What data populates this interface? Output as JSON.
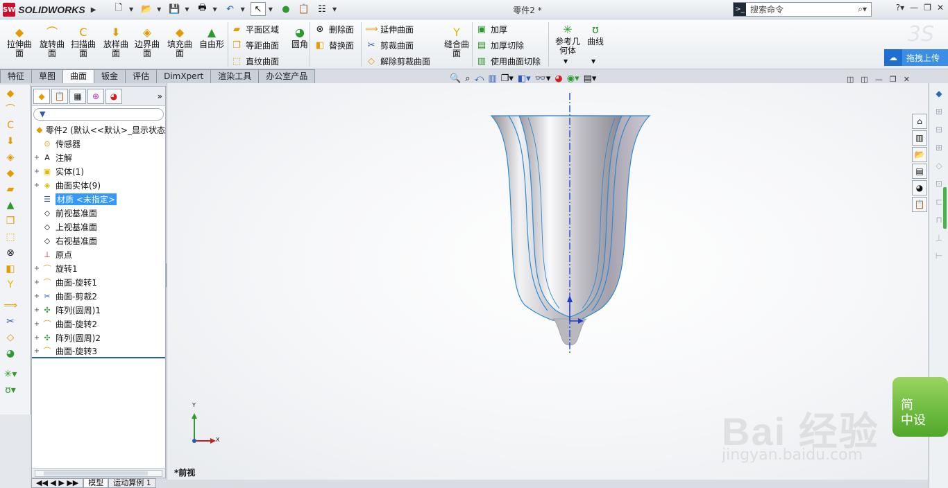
{
  "app": {
    "brand": "SOLIDWORKS",
    "logo_text": "SW",
    "document_title": "零件2 *",
    "search_placeholder": "搜索命令"
  },
  "ribbon": {
    "big_buttons": [
      {
        "label": "拉伸曲面",
        "icon": "extrude-surface-icon"
      },
      {
        "label": "旋转曲面",
        "icon": "revolve-surface-icon"
      },
      {
        "label": "扫描曲面",
        "icon": "sweep-surface-icon"
      },
      {
        "label": "放样曲面",
        "icon": "loft-surface-icon"
      },
      {
        "label": "边界曲面",
        "icon": "boundary-surface-icon"
      },
      {
        "label": "填充曲面",
        "icon": "fill-surface-icon"
      },
      {
        "label": "自由形",
        "icon": "freeform-icon"
      }
    ],
    "col1": [
      "平面区域",
      "等距曲面",
      "直纹曲面"
    ],
    "fillet": "圆角",
    "col2": [
      "删除面",
      "替换面"
    ],
    "col3": [
      "延伸曲面",
      "剪裁曲面",
      "解除剪裁曲面"
    ],
    "knit": "缝合曲面",
    "col4": [
      "加厚",
      "加厚切除",
      "使用曲面切除"
    ],
    "ref_geometry": "参考几何体",
    "curves": "曲线",
    "upload": "拖拽上传"
  },
  "tabs": [
    "特征",
    "草图",
    "曲面",
    "钣金",
    "评估",
    "DimXpert",
    "渲染工具",
    "办公室产品"
  ],
  "active_tab": "曲面",
  "tree": {
    "root": "零件2  (默认<<默认>_显示状态",
    "items": [
      {
        "label": "传感器",
        "exp": ""
      },
      {
        "label": "注解",
        "exp": "+"
      },
      {
        "label": "实体(1)",
        "exp": "+"
      },
      {
        "label": "曲面实体(9)",
        "exp": "+"
      },
      {
        "label": "材质 <未指定>",
        "exp": "",
        "selected": true
      },
      {
        "label": "前视基准面",
        "exp": ""
      },
      {
        "label": "上视基准面",
        "exp": ""
      },
      {
        "label": "右视基准面",
        "exp": ""
      },
      {
        "label": "原点",
        "exp": ""
      },
      {
        "label": "旋转1",
        "exp": "+"
      },
      {
        "label": "曲面-旋转1",
        "exp": "+"
      },
      {
        "label": "曲面-剪裁2",
        "exp": "+"
      },
      {
        "label": "阵列(圆周)1",
        "exp": "+"
      },
      {
        "label": "曲面-旋转2",
        "exp": "+"
      },
      {
        "label": "阵列(圆周)2",
        "exp": "+"
      },
      {
        "label": "曲面-旋转3",
        "exp": "+"
      }
    ]
  },
  "bottom_tabs": [
    "模型",
    "运动算例 1"
  ],
  "view_label": "*前视",
  "triad": {
    "x": "X",
    "y": "Y"
  },
  "watermark": {
    "main": "Bai 经验",
    "sub": "jingyan.baidu.com",
    "badge": "简\n中设"
  },
  "colors": {
    "accent": "#3399ff",
    "upload": "#3a8ee6",
    "model_edge": "#2a8ad4",
    "axis": "#1a3cc8"
  }
}
